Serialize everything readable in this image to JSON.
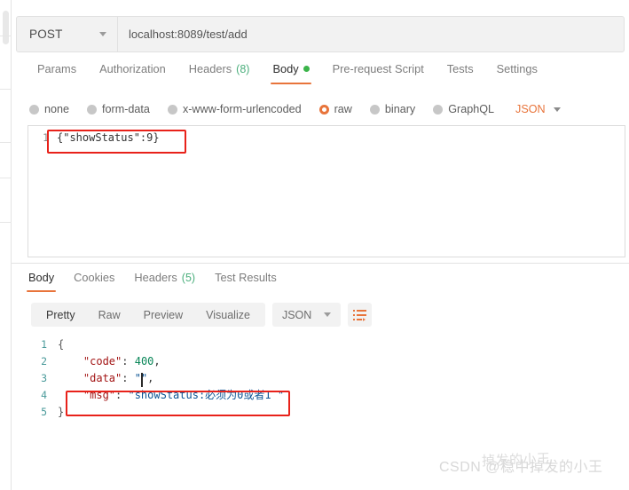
{
  "request": {
    "method": "POST",
    "url": "localhost:8089/test/add",
    "tabs": [
      {
        "label": "Params",
        "active": false,
        "count": "",
        "dot": false
      },
      {
        "label": "Authorization",
        "active": false,
        "count": "",
        "dot": false
      },
      {
        "label": "Headers",
        "active": false,
        "count": "(8)",
        "dot": false
      },
      {
        "label": "Body",
        "active": true,
        "count": "",
        "dot": true
      },
      {
        "label": "Pre-request Script",
        "active": false,
        "count": "",
        "dot": false
      },
      {
        "label": "Tests",
        "active": false,
        "count": "",
        "dot": false
      },
      {
        "label": "Settings",
        "active": false,
        "count": "",
        "dot": false
      }
    ],
    "body_types": [
      {
        "label": "none",
        "selected": false
      },
      {
        "label": "form-data",
        "selected": false
      },
      {
        "label": "x-www-form-urlencoded",
        "selected": false
      },
      {
        "label": "raw",
        "selected": true
      },
      {
        "label": "binary",
        "selected": false
      },
      {
        "label": "GraphQL",
        "selected": false
      }
    ],
    "format_selected": "JSON",
    "editor": {
      "line_number": "1",
      "content": "{\"showStatus\":9}"
    }
  },
  "response": {
    "tabs": [
      {
        "label": "Body",
        "active": true,
        "count": ""
      },
      {
        "label": "Cookies",
        "active": false,
        "count": ""
      },
      {
        "label": "Headers",
        "active": false,
        "count": "(5)"
      },
      {
        "label": "Test Results",
        "active": false,
        "count": ""
      }
    ],
    "view_buttons": [
      {
        "label": "Pretty",
        "active": true
      },
      {
        "label": "Raw",
        "active": false
      },
      {
        "label": "Preview",
        "active": false
      },
      {
        "label": "Visualize",
        "active": false
      }
    ],
    "format_selected": "JSON",
    "wrap_icon": "word-wrap-icon",
    "body_lines": [
      {
        "num": "1",
        "indent": 0,
        "key": "",
        "sep": "",
        "value": "{",
        "kind": "brace",
        "trail": ""
      },
      {
        "num": "2",
        "indent": 1,
        "key": "\"code\"",
        "sep": ": ",
        "value": "400",
        "kind": "num",
        "trail": ","
      },
      {
        "num": "3",
        "indent": 1,
        "key": "\"data\"",
        "sep": ": ",
        "value": "\"\"",
        "kind": "str",
        "trail": ","
      },
      {
        "num": "4",
        "indent": 1,
        "key": "\"msg\"",
        "sep": ": ",
        "value": "\"showStatus:必须为0或者1 \"",
        "kind": "str",
        "trail": ""
      },
      {
        "num": "5",
        "indent": 0,
        "key": "",
        "sep": "",
        "value": "}",
        "kind": "brace",
        "trail": ""
      }
    ]
  },
  "watermark": {
    "text": "CSDN @稳中掉发的小王",
    "overlay": "掉发的小王"
  },
  "colors": {
    "accent": "#e8743b",
    "highlight_box": "#e8221a",
    "dot_green": "#3bb44a",
    "count_green": "#4caf7d"
  }
}
